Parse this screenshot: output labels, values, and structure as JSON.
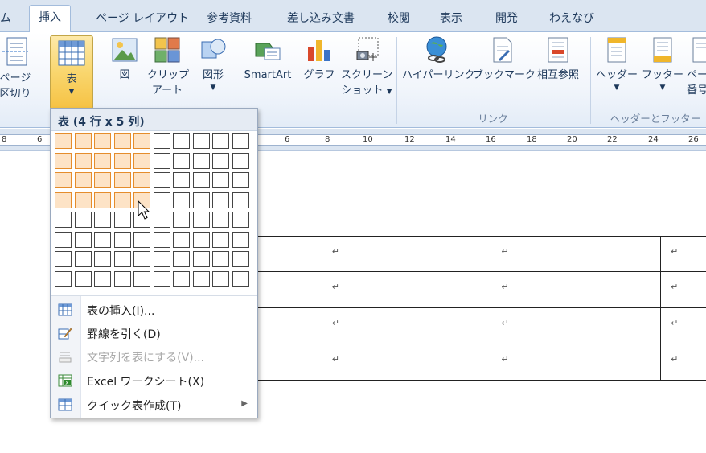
{
  "tabs": [
    {
      "label": "ム",
      "active": false
    },
    {
      "label": "挿入",
      "active": true
    },
    {
      "label": "ページ レイアウト",
      "active": false
    },
    {
      "label": "参考資料",
      "active": false
    },
    {
      "label": "差し込み文書",
      "active": false
    },
    {
      "label": "校閲",
      "active": false
    },
    {
      "label": "表示",
      "active": false
    },
    {
      "label": "開発",
      "active": false
    },
    {
      "label": "わえなび",
      "active": false
    }
  ],
  "ribbon": {
    "page_break": {
      "line1": "ページ",
      "line2": "区切り"
    },
    "table": {
      "label": "表",
      "icon": "table-icon"
    },
    "picture": {
      "label": "図",
      "icon": "picture-icon"
    },
    "clipart": {
      "line1": "クリップ",
      "line2": "アート",
      "icon": "clipart-icon"
    },
    "shapes": {
      "label": "図形",
      "icon": "shapes-icon"
    },
    "smartart": {
      "label": "SmartArt",
      "icon": "smartart-icon"
    },
    "chart": {
      "label": "グラフ",
      "icon": "chart-icon"
    },
    "screenshot": {
      "line1": "スクリーン",
      "line2": "ショット",
      "icon": "screenshot-icon"
    },
    "hyperlink": {
      "label": "ハイパーリンク",
      "icon": "hyperlink-icon"
    },
    "bookmark": {
      "label": "ブックマーク",
      "icon": "bookmark-icon"
    },
    "crossref": {
      "label": "相互参照",
      "icon": "crossref-icon"
    },
    "header": {
      "label": "ヘッダー",
      "icon": "header-icon"
    },
    "footer": {
      "label": "フッター",
      "icon": "footer-icon"
    },
    "pagenum": {
      "line1": "ペー",
      "line2": "番号",
      "icon": "page-number-icon"
    },
    "group_links": "リンク",
    "group_headerfooter": "ヘッダーとフッター"
  },
  "ruler": {
    "left_numbers": [
      "8",
      "6"
    ],
    "right_numbers": [
      "6",
      "8",
      "10",
      "12",
      "14",
      "16",
      "18",
      "20",
      "22",
      "24",
      "26"
    ]
  },
  "table_dropdown": {
    "title": "表 (4 行 x 5 列)",
    "grid_rows": 8,
    "grid_cols": 10,
    "selected_rows": 4,
    "selected_cols": 5,
    "menu": [
      {
        "label": "表の挿入(I)...",
        "icon": "insert-table-icon",
        "disabled": false,
        "submenu": false
      },
      {
        "label": "罫線を引く(D)",
        "icon": "draw-table-icon",
        "disabled": false,
        "submenu": false
      },
      {
        "label": "文字列を表にする(V)...",
        "icon": "text-to-table-icon",
        "disabled": true,
        "submenu": false
      },
      {
        "label": "Excel ワークシート(X)",
        "icon": "excel-sheet-icon",
        "disabled": false,
        "submenu": false
      },
      {
        "label": "クイック表作成(T)",
        "icon": "quick-table-icon",
        "disabled": false,
        "submenu": true
      }
    ]
  },
  "document": {
    "paragraph_mark": "↵",
    "table_rows": 4
  },
  "colors": {
    "highlight_border": "#e58d2c",
    "highlight_fill": "#fde3c6",
    "tabbar_bg": "#dbe5f1",
    "active_button": "#f9d66e"
  }
}
